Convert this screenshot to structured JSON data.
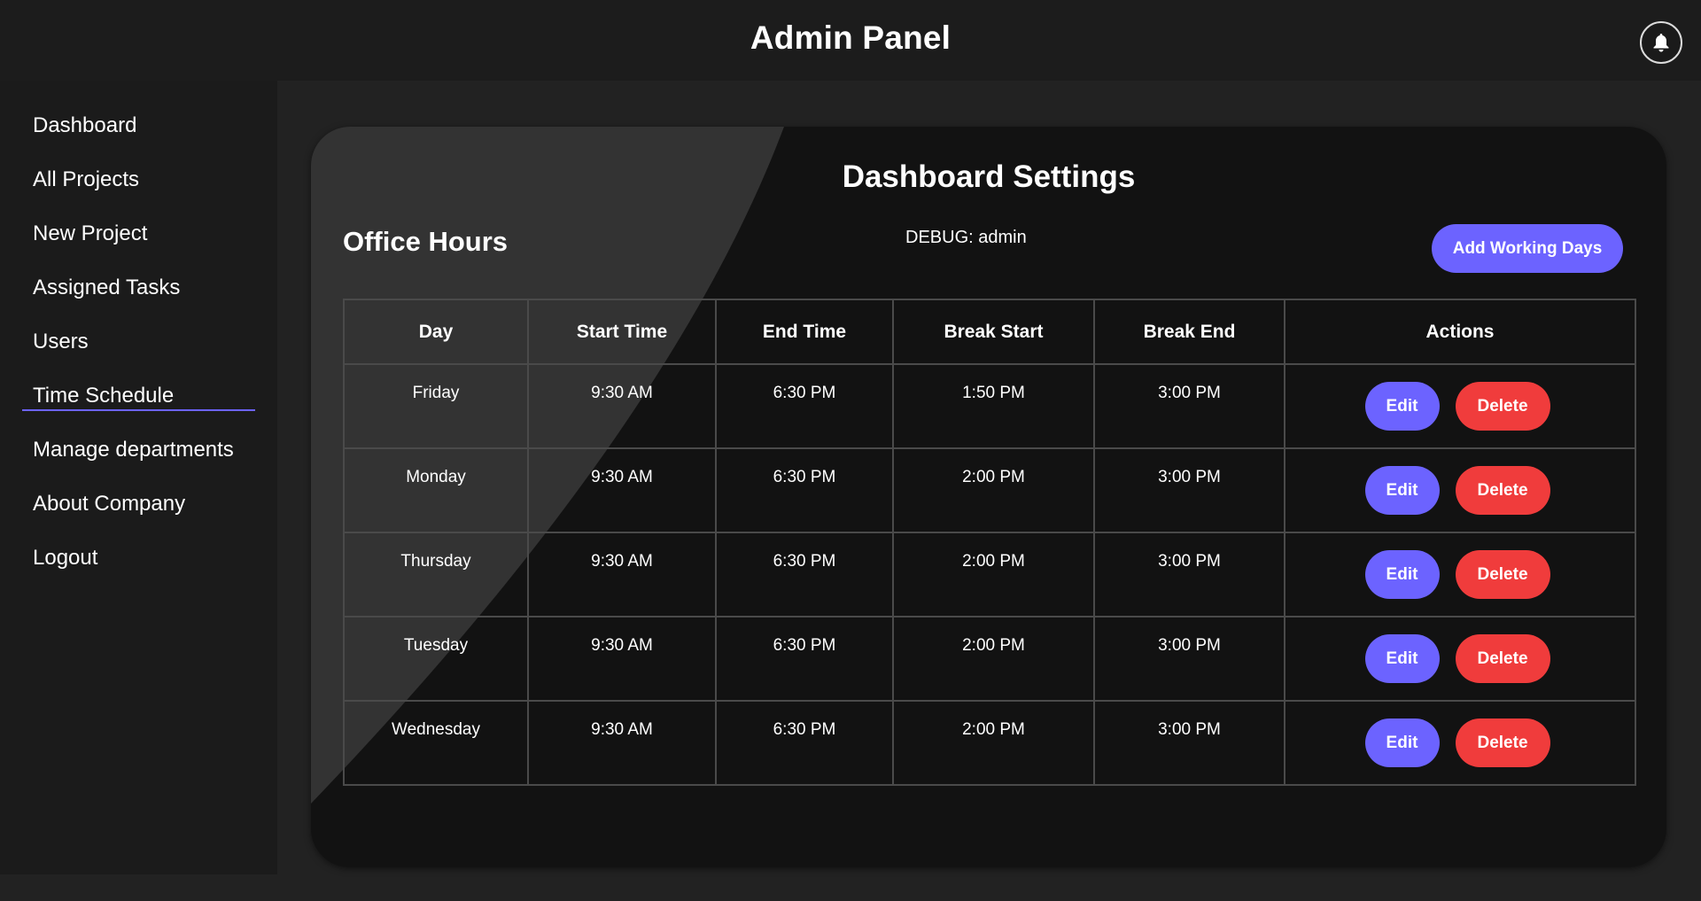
{
  "header": {
    "title": "Admin Panel",
    "notification_icon": "bell-icon"
  },
  "sidebar": {
    "active": "Time Schedule",
    "accent_color": "#6c63ff",
    "items": [
      {
        "label": "Dashboard"
      },
      {
        "label": "All Projects"
      },
      {
        "label": "New Project"
      },
      {
        "label": "Assigned Tasks"
      },
      {
        "label": "Users"
      },
      {
        "label": "Time Schedule"
      },
      {
        "label": "Manage departments"
      },
      {
        "label": "About Company"
      },
      {
        "label": "Logout"
      }
    ]
  },
  "main": {
    "title": "Dashboard Settings",
    "section_title": "Office Hours",
    "debug_text": "DEBUG: admin",
    "add_button_label": "Add Working Days",
    "table": {
      "headers": [
        "Day",
        "Start Time",
        "End Time",
        "Break Start",
        "Break End",
        "Actions"
      ],
      "rows": [
        {
          "day": "Friday",
          "start": "9:30 AM",
          "end": "6:30 PM",
          "break_start": "1:50 PM",
          "break_end": "3:00 PM"
        },
        {
          "day": "Monday",
          "start": "9:30 AM",
          "end": "6:30 PM",
          "break_start": "2:00 PM",
          "break_end": "3:00 PM"
        },
        {
          "day": "Thursday",
          "start": "9:30 AM",
          "end": "6:30 PM",
          "break_start": "2:00 PM",
          "break_end": "3:00 PM"
        },
        {
          "day": "Tuesday",
          "start": "9:30 AM",
          "end": "6:30 PM",
          "break_start": "2:00 PM",
          "break_end": "3:00 PM"
        },
        {
          "day": "Wednesday",
          "start": "9:30 AM",
          "end": "6:30 PM",
          "break_start": "2:00 PM",
          "break_end": "3:00 PM"
        }
      ],
      "edit_label": "Edit",
      "delete_label": "Delete"
    }
  },
  "colors": {
    "primary_button": "#6c63ff",
    "danger_button": "#f03c3c",
    "background": "#222222",
    "card": "#121212"
  }
}
